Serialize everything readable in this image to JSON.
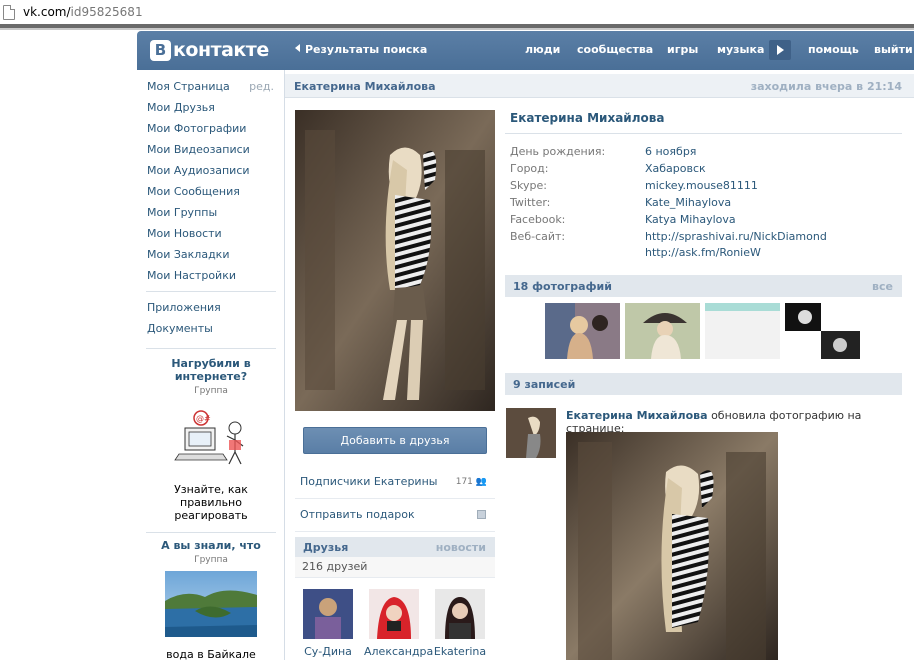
{
  "browser": {
    "url_host": "vk.com/",
    "url_path": "id95825681"
  },
  "header": {
    "logo_letter": "В",
    "logo_text": "контакте",
    "back_label": "Результаты поиска",
    "nav": [
      "люди",
      "сообщества",
      "игры",
      "музыка",
      "помощь",
      "выйти"
    ],
    "colors": {
      "header_bg": "#4a6f97",
      "link": "#2b587a"
    }
  },
  "sidebar": {
    "items": [
      {
        "label": "Моя Страница",
        "extra": "ред."
      },
      {
        "label": "Мои Друзья"
      },
      {
        "label": "Мои Фотографии"
      },
      {
        "label": "Мои Видеозаписи"
      },
      {
        "label": "Мои Аудиозаписи"
      },
      {
        "label": "Мои Сообщения"
      },
      {
        "label": "Мои Группы"
      },
      {
        "label": "Мои Новости"
      },
      {
        "label": "Мои Закладки"
      },
      {
        "label": "Мои Настройки"
      }
    ],
    "extra_items": [
      {
        "label": "Приложения"
      },
      {
        "label": "Документы"
      }
    ],
    "ads": [
      {
        "title": "Нагрубили в интернете?",
        "sub": "Группа",
        "text": "Узнайте, как правильно реагировать"
      },
      {
        "title": "А вы знали, что",
        "sub": "Группа",
        "text": "вода в Байкале"
      }
    ]
  },
  "profile": {
    "title_name": "Екатерина Михайлова",
    "last_seen": "заходила вчера в 21:14",
    "add_friend": "Добавить в друзья",
    "followers_label": "Подписчики Екатерины",
    "followers_count": "171",
    "gift_label": "Отправить подарок",
    "friends_title": "Друзья",
    "friends_news": "новости",
    "friends_count": "216 друзей",
    "friends": [
      {
        "name": "Су-Дина"
      },
      {
        "name": "Александра"
      },
      {
        "name": "Ekaterina"
      }
    ],
    "name": "Екатерина Михайлова",
    "info": [
      {
        "key": "День рождения:",
        "value": "6 ноября"
      },
      {
        "key": "Город:",
        "value": "Хабаровск"
      },
      {
        "key": "Skype:",
        "value": "mickey.mouse81111"
      },
      {
        "key": "Twitter:",
        "value": "Kate_Mihaylova"
      },
      {
        "key": "Facebook:",
        "value": "Katya Mihaylova"
      },
      {
        "key": "Веб-сайт:",
        "value": "http://sprashivai.ru/NickDiamond"
      }
    ],
    "website2": "http://ask.fm/RonieW",
    "photos_title": "18 фотографий",
    "photos_all": "все",
    "posts_title": "9 записей",
    "post": {
      "author": "Екатерина Михайлова",
      "action": "обновила фотографию на странице:"
    }
  }
}
